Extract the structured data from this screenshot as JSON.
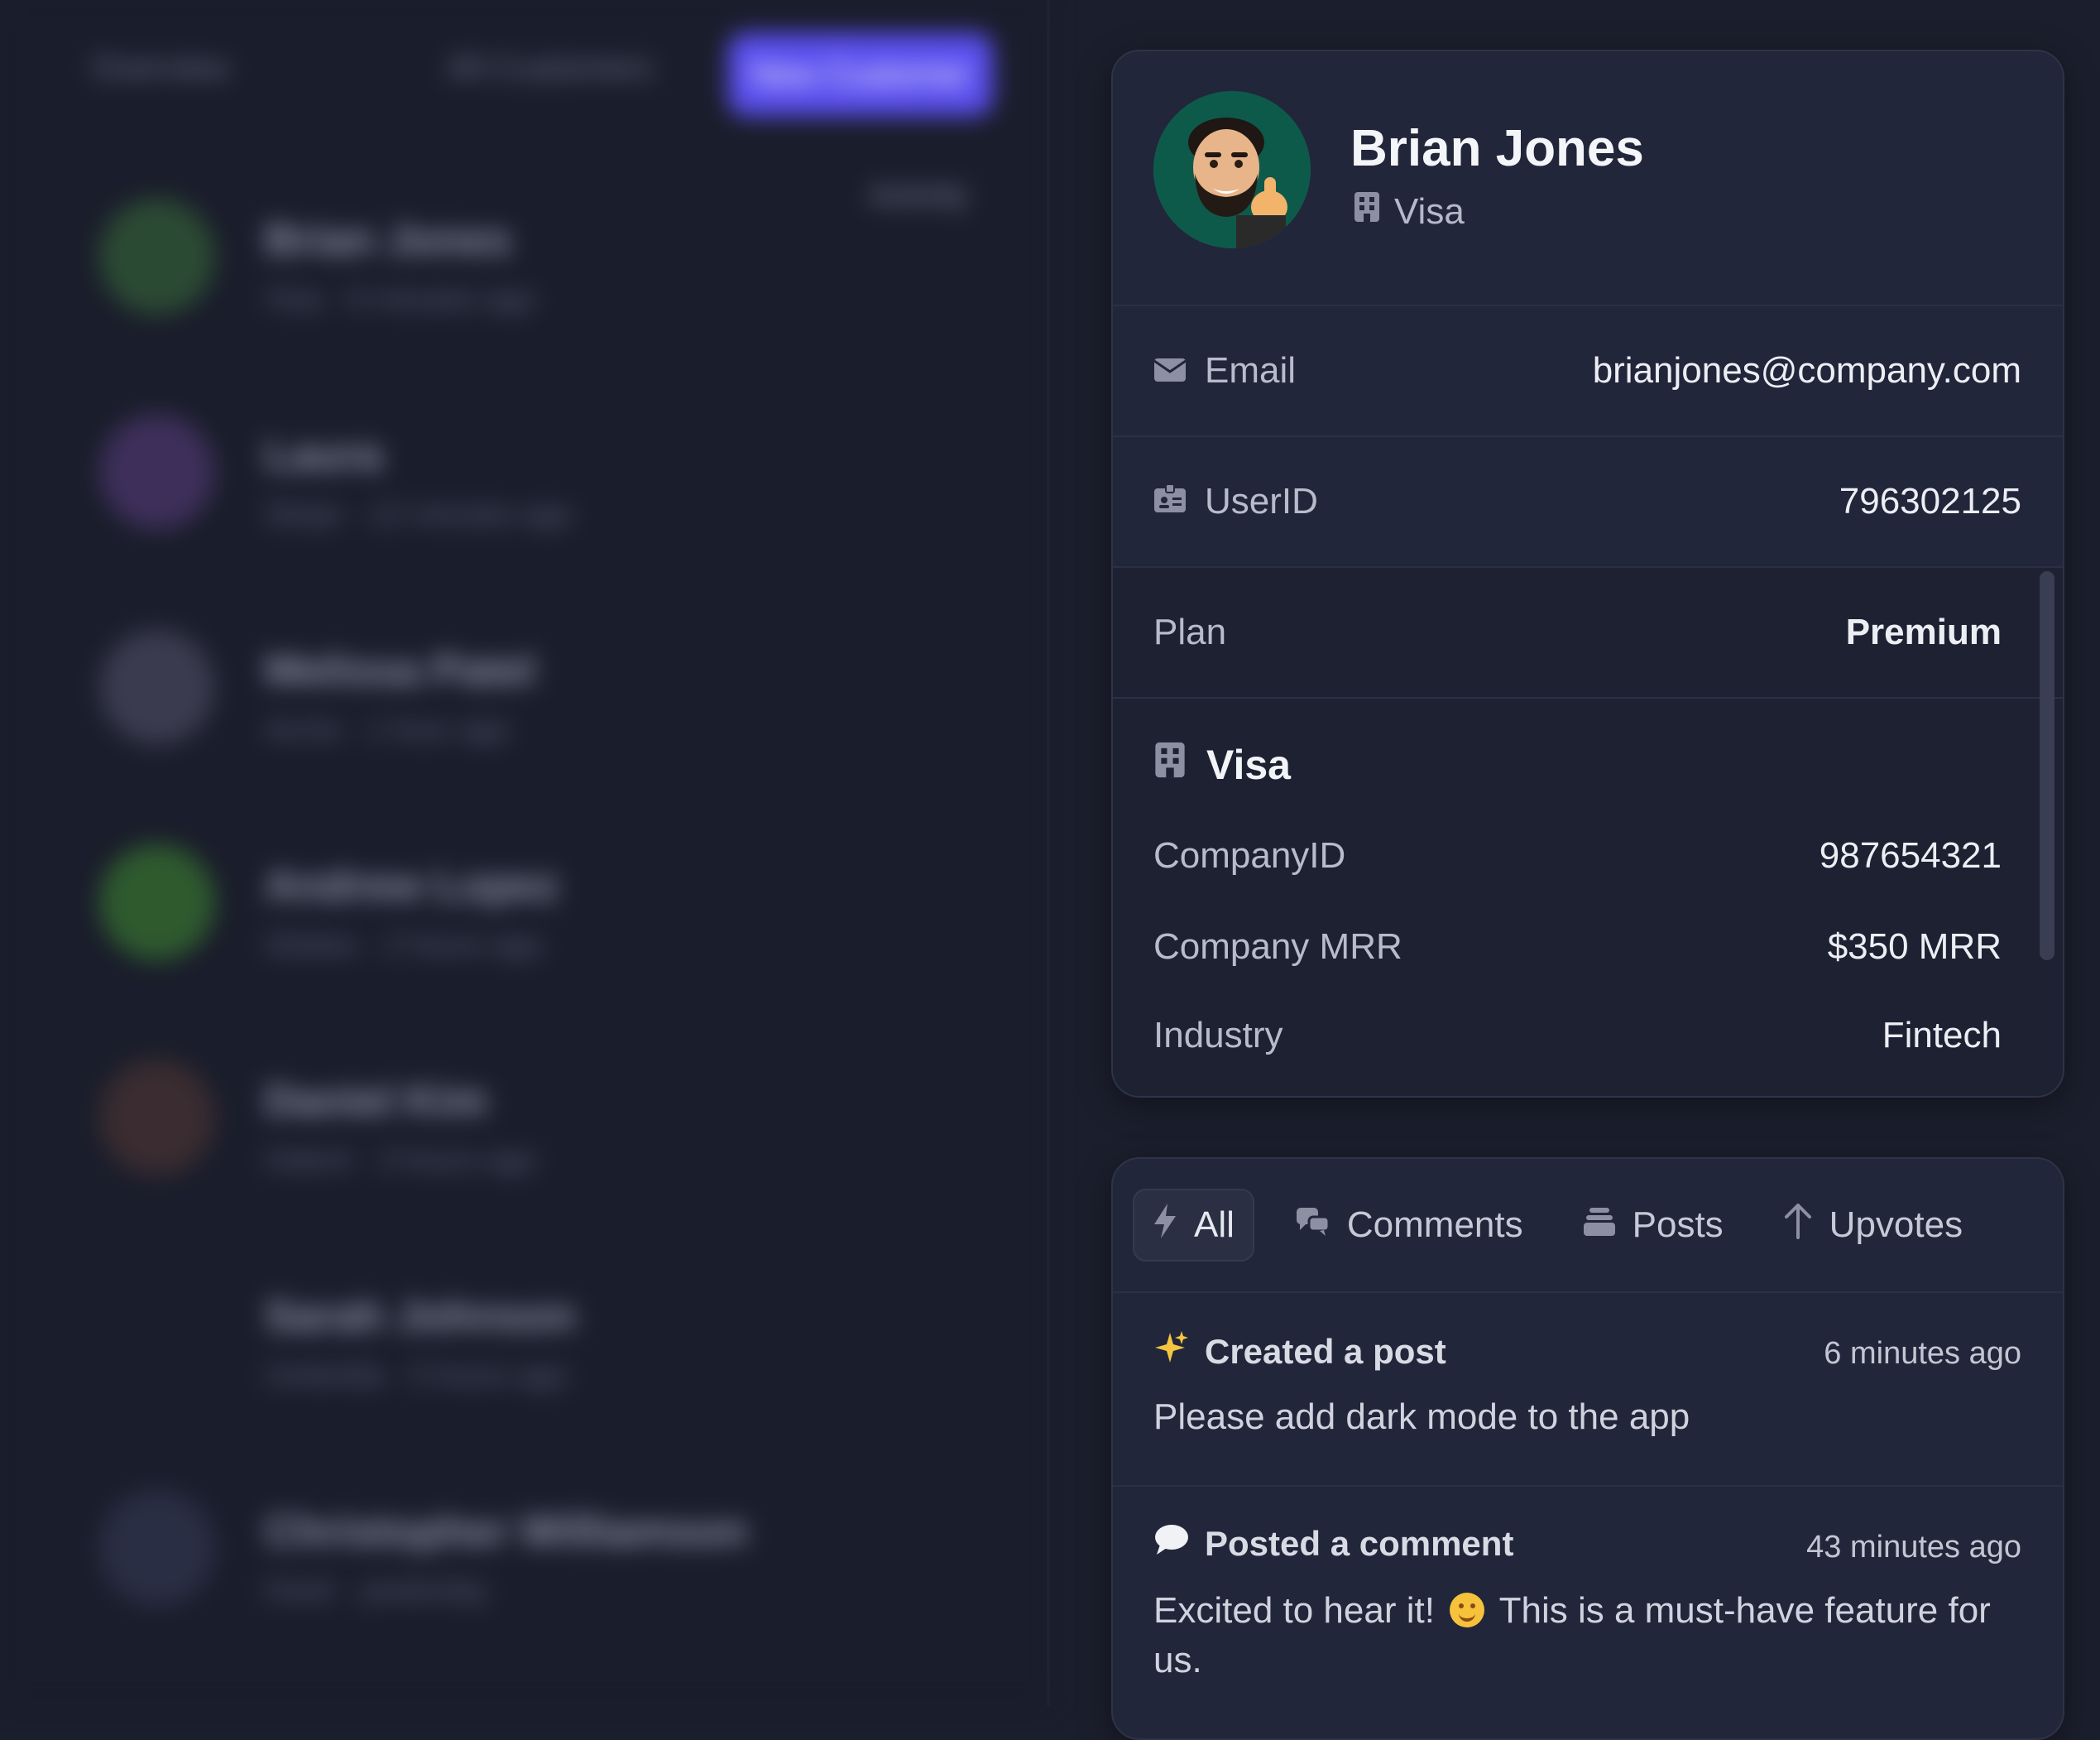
{
  "background": {
    "top_links": [
      "Overview",
      "All Customers"
    ],
    "primary_button": "New Customer",
    "badge": "Activity",
    "list": [
      {
        "name": "Brian Jones",
        "meta": "Visa · 6 minutes ago",
        "avatar_color": "#2b4a33"
      },
      {
        "name": "Laura",
        "meta": "Stripe · 12 minutes ago",
        "avatar_color": "#3d2f5a"
      },
      {
        "name": "Melissa Patel",
        "meta": "Acme · 1 hour ago",
        "avatar_color": "#3a3b4e"
      },
      {
        "name": "Andrew Lopez",
        "meta": "Globex · 2 hours ago",
        "avatar_color": "#2e5a2e"
      },
      {
        "name": "Daniel Kim",
        "meta": "Initech · 3 hours ago",
        "avatar_color": "#3a2c30"
      },
      {
        "name": "Sarah Johnson",
        "meta": "Umbrella · 5 hours ago",
        "avatar_color": "#1a1d2b"
      },
      {
        "name": "Christopher Williamson",
        "meta": "Hooli · yesterday",
        "avatar_color": "#2a2e44"
      }
    ]
  },
  "profile": {
    "name": "Brian Jones",
    "company": "Visa",
    "avatar_icon": "memoji-avatar",
    "email_label": "Email",
    "email_value": "brianjones@company.com",
    "userid_label": "UserID",
    "userid_value": "796302125",
    "plan_label": "Plan",
    "plan_value": "Premium",
    "company_section": {
      "title": "Visa",
      "companyid_label": "CompanyID",
      "companyid_value": "987654321",
      "mrr_label": "Company MRR",
      "mrr_value": "$350 MRR",
      "industry_label": "Industry",
      "industry_value": "Fintech"
    }
  },
  "activity": {
    "tabs": [
      {
        "label": "All",
        "icon": "bolt-icon"
      },
      {
        "label": "Comments",
        "icon": "chat-bubbles-icon"
      },
      {
        "label": "Posts",
        "icon": "stack-icon"
      },
      {
        "label": "Upvotes",
        "icon": "arrow-up-icon"
      }
    ],
    "items": [
      {
        "icon": "sparkles",
        "title": "Created a post",
        "time": "6 minutes ago",
        "body": "Please add dark mode to the app"
      },
      {
        "icon": "speech-bubble",
        "title": "Posted a comment",
        "time": "43 minutes ago",
        "body_before": "Excited to hear it! ",
        "body_after": " This is a must-have feature for us."
      }
    ]
  },
  "colors": {
    "page_bg": "#1b1e2c",
    "card_bg": "#22263a",
    "accent": "#5a4ff0",
    "avatar_bg": "#0e5a4a"
  }
}
